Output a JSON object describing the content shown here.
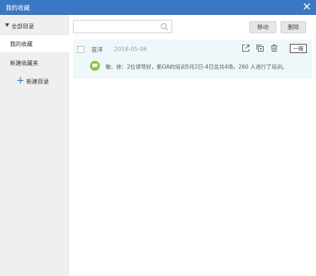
{
  "window": {
    "title": "我的收藏"
  },
  "sidebar": {
    "root_label": "全部目录",
    "items": [
      {
        "label": "我的收藏"
      },
      {
        "label": "新建收藏夹"
      }
    ],
    "new_dir_label": "新建目录"
  },
  "search": {
    "placeholder": "",
    "value": ""
  },
  "toolbar": {
    "move_label": "移动",
    "delete_label": "删除"
  },
  "favorites": [
    {
      "author": "苗洋",
      "date": "2018-05-06",
      "tag": "一般",
      "content": "敏、徐：2位领导好，新OA的培训5月2日-4日总共4场，260 人进行了培训。"
    }
  ],
  "colors": {
    "titlebar": "#3a78c4",
    "accent": "#3a78c4",
    "row_bg": "#eef8fb",
    "bubble": "#8cc63f"
  }
}
